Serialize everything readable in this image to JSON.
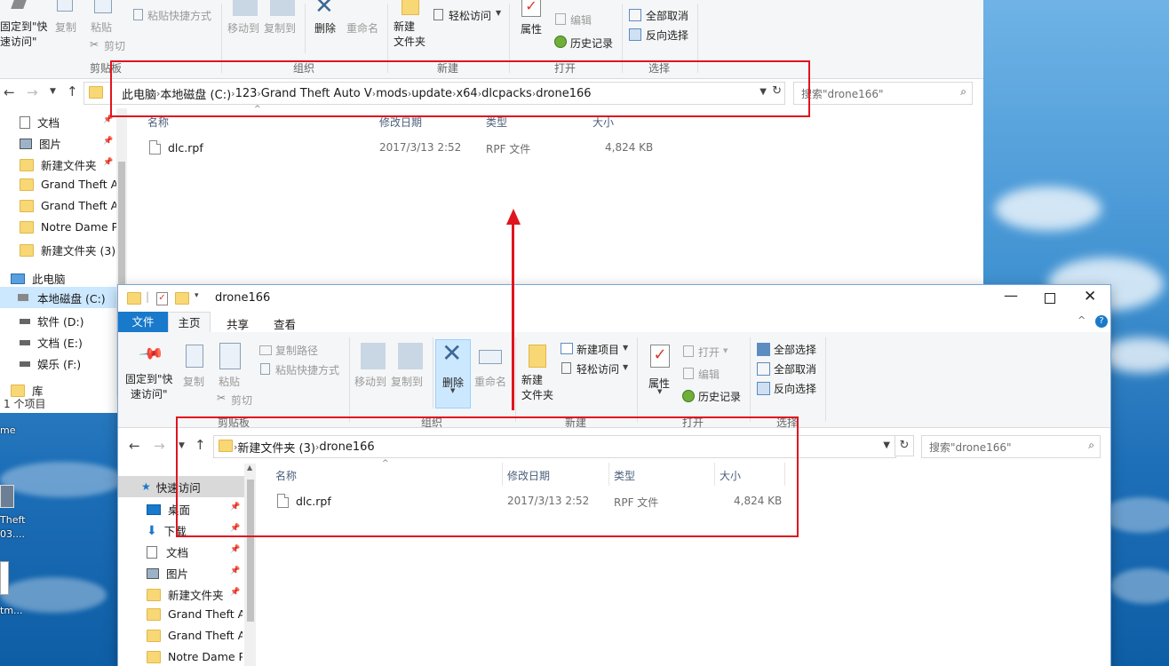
{
  "back_window": {
    "ribbon": {
      "pin_label": "固定到\"快\n速访问\"",
      "copy": "复制",
      "paste": "粘贴",
      "paste_shortcut": "粘贴快捷方式",
      "cut": "剪切",
      "move_to": "移动到",
      "copy_to": "复制到",
      "delete": "删除",
      "rename": "重命名",
      "new_folder": "新建\n文件夹",
      "easy_access": "轻松访问",
      "properties": "属性",
      "edit": "编辑",
      "history": "历史记录",
      "select_none": "全部取消",
      "invert_selection": "反向选择",
      "groups": [
        "剪贴板",
        "组织",
        "新建",
        "打开",
        "选择"
      ]
    },
    "address": {
      "crumbs": [
        "此电脑",
        "本地磁盘 (C:)",
        "123",
        "Grand Theft Auto V",
        "mods",
        "update",
        "x64",
        "dlcpacks",
        "drone166"
      ]
    },
    "search_placeholder": "搜索\"drone166\"",
    "columns": {
      "name": "名称",
      "date": "修改日期",
      "type": "类型",
      "size": "大小"
    },
    "files": [
      {
        "name": "dlc.rpf",
        "date": "2017/3/13 2:52",
        "type": "RPF 文件",
        "size": "4,824 KB"
      }
    ],
    "nav": [
      "文档",
      "图片",
      "新建文件夹",
      "Grand Theft Au",
      "Grand Theft Au",
      "Notre Dame Pa",
      "新建文件夹 (3)",
      "此电脑",
      "本地磁盘 (C:)",
      "软件 (D:)",
      "文档 (E:)",
      "娱乐 (F:)",
      "库"
    ],
    "status": "1 个项目"
  },
  "desktop_labels": [
    "me",
    "Theft\n03....",
    "tm..."
  ],
  "front_window": {
    "title": "drone166",
    "tabs": [
      "文件",
      "主页",
      "共享",
      "查看"
    ],
    "ribbon": {
      "pin_label": "固定到\"快\n速访问\"",
      "copy": "复制",
      "paste": "粘贴",
      "copy_path": "复制路径",
      "paste_shortcut": "粘贴快捷方式",
      "cut": "剪切",
      "move_to": "移动到",
      "copy_to": "复制到",
      "delete": "删除",
      "rename": "重命名",
      "new_item": "新建项目",
      "easy_access": "轻松访问",
      "new_folder": "新建\n文件夹",
      "properties": "属性",
      "open": "打开",
      "edit": "编辑",
      "history": "历史记录",
      "select_all": "全部选择",
      "select_none": "全部取消",
      "invert_selection": "反向选择",
      "groups": [
        "剪贴板",
        "组织",
        "新建",
        "打开",
        "选择"
      ]
    },
    "address": {
      "crumbs": [
        "新建文件夹 (3)",
        "drone166"
      ]
    },
    "search_placeholder": "搜索\"drone166\"",
    "columns": {
      "name": "名称",
      "date": "修改日期",
      "type": "类型",
      "size": "大小"
    },
    "files": [
      {
        "name": "dlc.rpf",
        "date": "2017/3/13 2:52",
        "type": "RPF 文件",
        "size": "4,824 KB"
      }
    ],
    "nav": [
      "快速访问",
      "桌面",
      "下载",
      "文档",
      "图片",
      "新建文件夹",
      "Grand Theft Au",
      "Grand Theft Au",
      "Notre Dame Pa"
    ]
  },
  "colors": {
    "annotation_red": "#e0141e",
    "accent_blue": "#1979ca"
  }
}
